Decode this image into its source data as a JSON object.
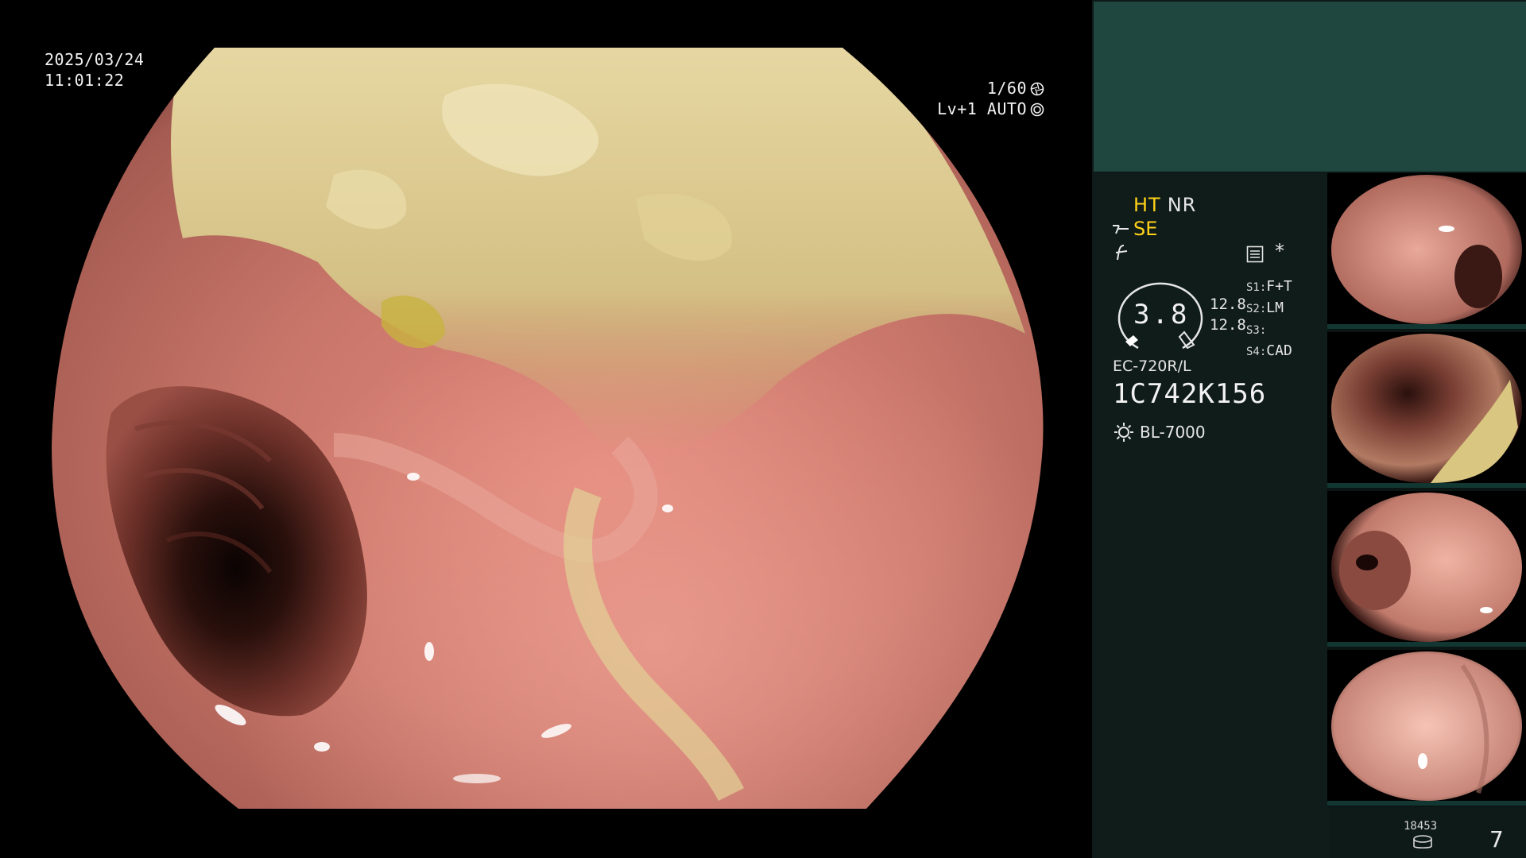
{
  "overlay": {
    "date": "2025/03/24",
    "time": "11:01:22",
    "shutter": "1/60",
    "level": "Lv+1",
    "iris": "AUTO"
  },
  "panel": {
    "mode_ht": "HT",
    "mode_nr": "NR",
    "mode_se": "SE",
    "star": "*",
    "zoom_value": "3.8",
    "val_top": "12.8",
    "val_bottom": "12.8",
    "slots": [
      {
        "label": "S1:",
        "value": "F+T"
      },
      {
        "label": "S2:",
        "value": "LM"
      },
      {
        "label": "S3:",
        "value": ""
      },
      {
        "label": "S4:",
        "value": "CAD"
      }
    ],
    "scope_model": "EC-720R/L",
    "serial": "1C742K156",
    "light_source": "BL-7000"
  },
  "footer": {
    "count": "18453",
    "page": "7"
  },
  "thumbnails": [
    {
      "name": "thumb-1"
    },
    {
      "name": "thumb-2"
    },
    {
      "name": "thumb-3"
    },
    {
      "name": "thumb-4"
    }
  ]
}
